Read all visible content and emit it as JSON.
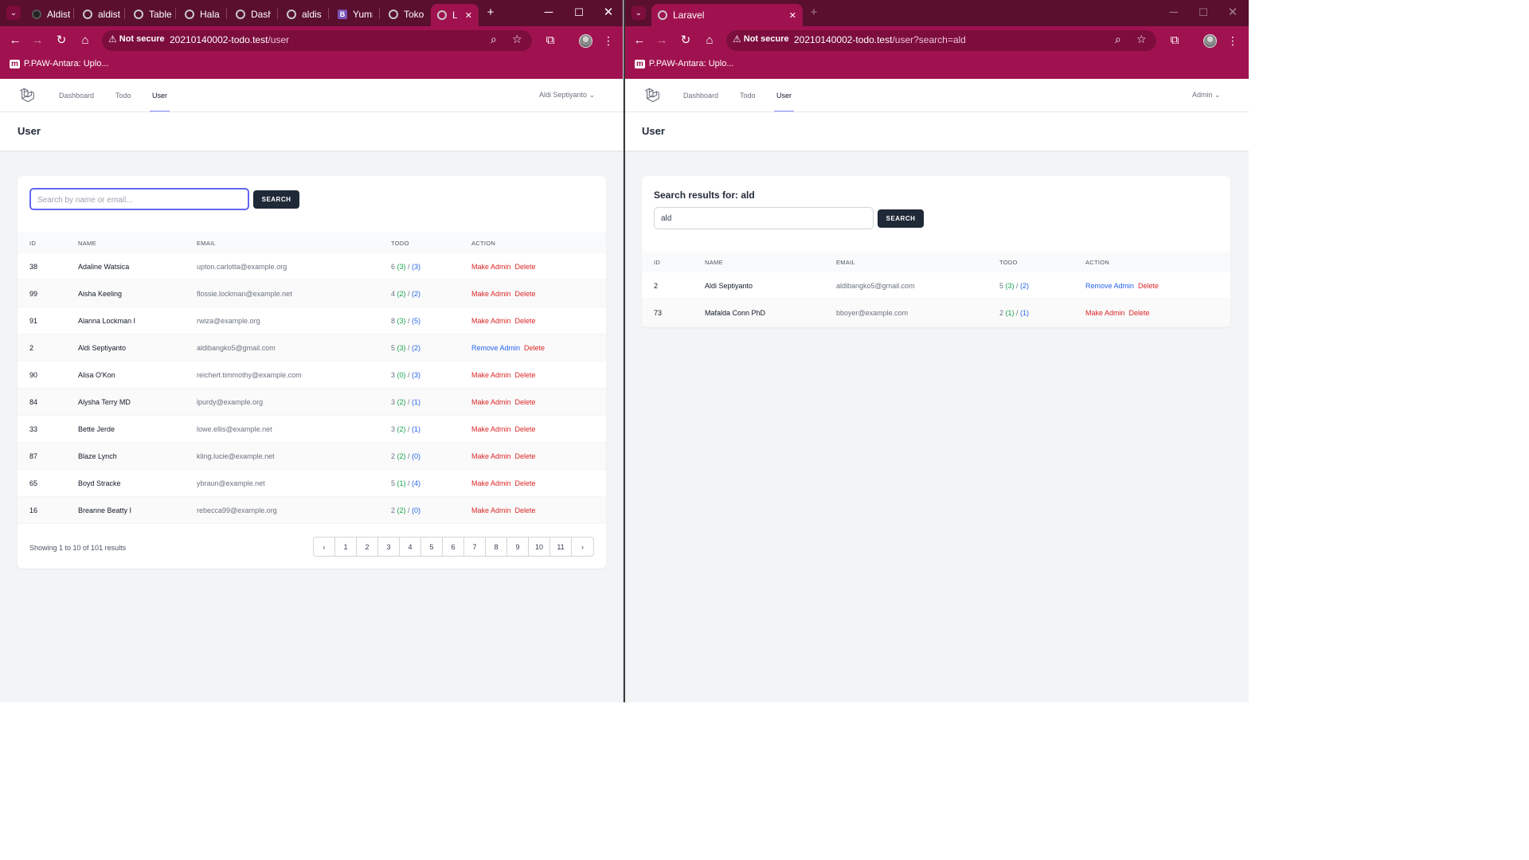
{
  "left": {
    "tabs": [
      "Aldist",
      "aldist",
      "Table",
      "Halan",
      "Dashb",
      "aldist",
      "Yumm",
      "Toko",
      "L"
    ],
    "security": "Not secure",
    "url_host": "20210140002-todo.test",
    "url_path": "/user",
    "bookmark": "P.PAW-Antara: Uplo...",
    "nav": {
      "dashboard": "Dashboard",
      "todo": "Todo",
      "user": "User",
      "account": "Aldi Septiyanto"
    },
    "page_title": "User",
    "search": {
      "placeholder": "Search by name or email...",
      "button": "SEARCH"
    },
    "columns": [
      "ID",
      "NAME",
      "EMAIL",
      "TODO",
      "ACTION"
    ],
    "rows": [
      {
        "id": "38",
        "name": "Adaline Watsica",
        "email": "upton.carlotta@example.org",
        "total": "6",
        "done": "(3)",
        "pending": "(3)",
        "admin": "Make Admin",
        "delete": "Delete"
      },
      {
        "id": "99",
        "name": "Aisha Keeling",
        "email": "flossie.lockman@example.net",
        "total": "4",
        "done": "(2)",
        "pending": "(2)",
        "admin": "Make Admin",
        "delete": "Delete"
      },
      {
        "id": "91",
        "name": "Alanna Lockman I",
        "email": "rwiza@example.org",
        "total": "8",
        "done": "(3)",
        "pending": "(5)",
        "admin": "Make Admin",
        "delete": "Delete"
      },
      {
        "id": "2",
        "name": "Aldi Septiyanto",
        "email": "aldibangko5@gmail.com",
        "total": "5",
        "done": "(3)",
        "pending": "(2)",
        "admin": "Remove Admin",
        "delete": "Delete"
      },
      {
        "id": "90",
        "name": "Alisa O'Kon",
        "email": "reichert.timmothy@example.com",
        "total": "3",
        "done": "(0)",
        "pending": "(3)",
        "admin": "Make Admin",
        "delete": "Delete"
      },
      {
        "id": "84",
        "name": "Alysha Terry MD",
        "email": "lpurdy@example.org",
        "total": "3",
        "done": "(2)",
        "pending": "(1)",
        "admin": "Make Admin",
        "delete": "Delete"
      },
      {
        "id": "33",
        "name": "Bette Jerde",
        "email": "lowe.ellis@example.net",
        "total": "3",
        "done": "(2)",
        "pending": "(1)",
        "admin": "Make Admin",
        "delete": "Delete"
      },
      {
        "id": "87",
        "name": "Blaze Lynch",
        "email": "kling.lucie@example.net",
        "total": "2",
        "done": "(2)",
        "pending": "(0)",
        "admin": "Make Admin",
        "delete": "Delete"
      },
      {
        "id": "65",
        "name": "Boyd Stracke",
        "email": "ybraun@example.net",
        "total": "5",
        "done": "(1)",
        "pending": "(4)",
        "admin": "Make Admin",
        "delete": "Delete"
      },
      {
        "id": "16",
        "name": "Breanne Beatty I",
        "email": "rebecca99@example.org",
        "total": "2",
        "done": "(2)",
        "pending": "(0)",
        "admin": "Make Admin",
        "delete": "Delete"
      }
    ],
    "showing": "Showing 1 to 10 of 101 results",
    "pages": [
      "1",
      "2",
      "3",
      "4",
      "5",
      "6",
      "7",
      "8",
      "9",
      "10",
      "11"
    ]
  },
  "right": {
    "tabs": [
      "Laravel"
    ],
    "security": "Not secure",
    "url_host": "20210140002-todo.test",
    "url_path": "/user?search=ald",
    "bookmark": "P.PAW-Antara: Uplo...",
    "nav": {
      "dashboard": "Dashboard",
      "todo": "Todo",
      "user": "User",
      "account": "Admin"
    },
    "page_title": "User",
    "results_title": "Search results for: ald",
    "search": {
      "value": "ald",
      "button": "SEARCH"
    },
    "columns": [
      "ID",
      "NAME",
      "EMAIL",
      "TODO",
      "ACTION"
    ],
    "rows": [
      {
        "id": "2",
        "name": "Aldi Septiyanto",
        "email": "aldibangko5@gmail.com",
        "total": "5",
        "done": "(3)",
        "pending": "(2)",
        "admin": "Remove Admin",
        "delete": "Delete"
      },
      {
        "id": "73",
        "name": "Mafalda Conn PhD",
        "email": "bboyer@example.com",
        "total": "2",
        "done": "(1)",
        "pending": "(1)",
        "admin": "Make Admin",
        "delete": "Delete"
      }
    ]
  },
  "colors": {
    "chrome": "#a0124f",
    "tabstrip": "#5a0f2f",
    "make_admin": "#dc2626",
    "remove_admin": "#2563eb",
    "done_count": "#16a34a"
  }
}
